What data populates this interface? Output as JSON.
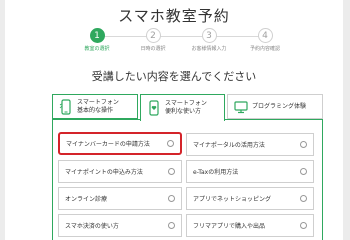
{
  "title": "スマホ教室予約",
  "steps": [
    {
      "number": "1",
      "label": "教室の選択"
    },
    {
      "number": "2",
      "label": "日時の選択"
    },
    {
      "number": "3",
      "label": "お客様情報入力"
    },
    {
      "number": "4",
      "label": "予約内容確認"
    }
  ],
  "heading": "受講したい内容を選んでください",
  "tabs": [
    {
      "line1": "スマートフォン",
      "line2": "基本的な操作",
      "icon": "smartphone-icon"
    },
    {
      "line1": "スマートフォン",
      "line2": "便利な使い方",
      "icon": "smartphone-heart-icon"
    },
    {
      "line1": "プログラミング体験",
      "line2": "",
      "icon": "monitor-icon"
    }
  ],
  "options": [
    "マイナンバーカードの申請方法",
    "マイナポータルの活用方法",
    "マイナポイントの申込み方法",
    "e-Taxの利用方法",
    "オンライン診療",
    "アプリでネットショッピング",
    "スマホ決済の使い方",
    "フリマアプリで購入や出品"
  ],
  "colors": {
    "accent": "#2fa85e",
    "highlight": "#d4242a"
  }
}
